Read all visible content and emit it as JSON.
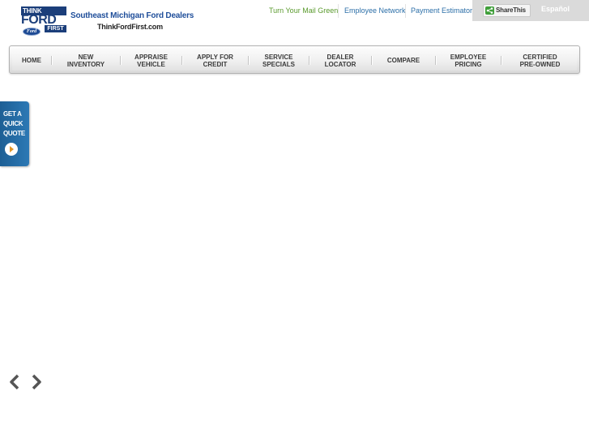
{
  "logo": {
    "think": "THINK",
    "ford": "FORD",
    "first": "FIRST",
    "oval": "Ford"
  },
  "brand": {
    "title": "Southeast Michigan Ford Dealers",
    "url": "ThinkFordFirst.com"
  },
  "top_links": [
    {
      "label": "Turn Your Mail Green"
    },
    {
      "label": "Employee Network"
    },
    {
      "label": "Payment Estimator"
    }
  ],
  "share": {
    "label": "ShareThis",
    "icon": "share-icon"
  },
  "espanol": "Español",
  "nav": [
    {
      "label": "HOME"
    },
    {
      "label": "NEW\nINVENTORY"
    },
    {
      "label": "APPRAISE\nVEHICLE"
    },
    {
      "label": "APPLY FOR\nCREDIT"
    },
    {
      "label": "SERVICE\nSPECIALS"
    },
    {
      "label": "DEALER\nLOCATOR"
    },
    {
      "label": "COMPARE"
    },
    {
      "label": "EMPLOYEE\nPRICING"
    },
    {
      "label": "CERTIFIED\nPRE-OWNED"
    }
  ],
  "quick_quote": {
    "label": "GET A\nQUICK\nQUOTE",
    "icon": "play-arrow-icon"
  },
  "carousel": {
    "prev_icon": "chevron-left-icon",
    "next_icon": "chevron-right-icon"
  },
  "colors": {
    "brand_blue": "#1f4e9a",
    "link_blue": "#2c6fa8",
    "link_green": "#5a9a2d",
    "quote_blue": "#2d79b5"
  }
}
